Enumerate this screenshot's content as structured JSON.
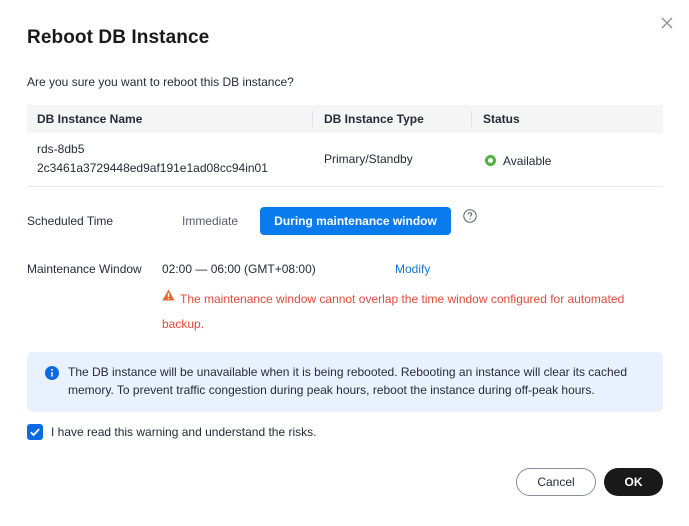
{
  "dialog": {
    "title": "Reboot DB Instance",
    "question": "Are you sure you want to reboot this DB instance?"
  },
  "table": {
    "headers": [
      "DB Instance Name",
      "DB Instance Type",
      "Status"
    ],
    "rows": [
      {
        "name": "rds-8db5",
        "id": "2c3461a3729448ed9af191e1ad08cc94in01",
        "type": "Primary/Standby",
        "status": "Available"
      }
    ]
  },
  "scheduled_time": {
    "label": "Scheduled Time",
    "options": [
      "Immediate",
      "During maintenance window"
    ],
    "selected": "During maintenance window"
  },
  "maintenance_window": {
    "label": "Maintenance Window",
    "value": "02:00 — 06:00 (GMT+08:00)",
    "modify_label": "Modify",
    "warning": "The maintenance window cannot overlap the time window configured for automated backup."
  },
  "info": {
    "text": "The DB instance will be unavailable when it is being rebooted. Rebooting an instance will clear its cached memory. To prevent traffic congestion during peak hours, reboot the instance during off-peak hours."
  },
  "acknowledge": {
    "label": "I have read this warning and understand the risks.",
    "checked": true
  },
  "buttons": {
    "cancel": "Cancel",
    "ok": "OK"
  },
  "colors": {
    "primary": "#0a7bec",
    "warning": "#e34a3b",
    "success": "#50b142",
    "info_bg": "#e8f1fd",
    "ok_button": "#191919"
  }
}
